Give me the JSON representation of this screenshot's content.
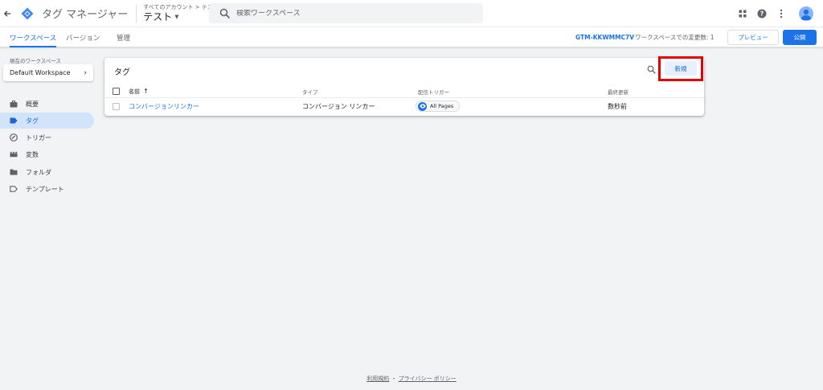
{
  "header": {
    "app_title": "タグ マネージャー",
    "account_breadcrumb": "すべてのアカウント > テスト",
    "container_name": "テスト",
    "search_placeholder": "検索ワークスペース"
  },
  "subnav": {
    "tabs": [
      {
        "label": "ワークスペース",
        "active": true
      },
      {
        "label": "バージョン",
        "active": false
      },
      {
        "label": "管理",
        "active": false
      }
    ],
    "container_id": "GTM-KKWMMC7V",
    "workspace_changes": "ワークスペースでの変更数: 1",
    "preview_label": "プレビュー",
    "publish_label": "公開"
  },
  "sidebar": {
    "workspace_label": "現在のワークスペース",
    "workspace_name": "Default Workspace",
    "items": [
      {
        "label": "概要",
        "icon": "briefcase-icon",
        "active": false
      },
      {
        "label": "タグ",
        "icon": "tag-icon",
        "active": true
      },
      {
        "label": "トリガー",
        "icon": "trigger-icon",
        "active": false
      },
      {
        "label": "変数",
        "icon": "variables-icon",
        "active": false
      },
      {
        "label": "フォルダ",
        "icon": "folder-icon",
        "active": false
      },
      {
        "label": "テンプレート",
        "icon": "template-icon",
        "active": false
      }
    ]
  },
  "tags_card": {
    "title": "タグ",
    "new_label": "新規",
    "columns": [
      "名前",
      "タイプ",
      "配信トリガー",
      "最終更新"
    ],
    "sort_arrow": "↑",
    "rows": [
      {
        "name": "コンバージョンリンカー",
        "type": "コンバージョン リンカー",
        "trigger": "All Pages",
        "last_updated": "数秒前"
      }
    ]
  },
  "footer": {
    "terms": "利用規約",
    "separator": "・",
    "privacy": "プライバシー ポリシー"
  },
  "colors": {
    "accent": "#1a73e8",
    "highlight": "#e50000",
    "active_nav_bg": "#d2e3fc"
  }
}
